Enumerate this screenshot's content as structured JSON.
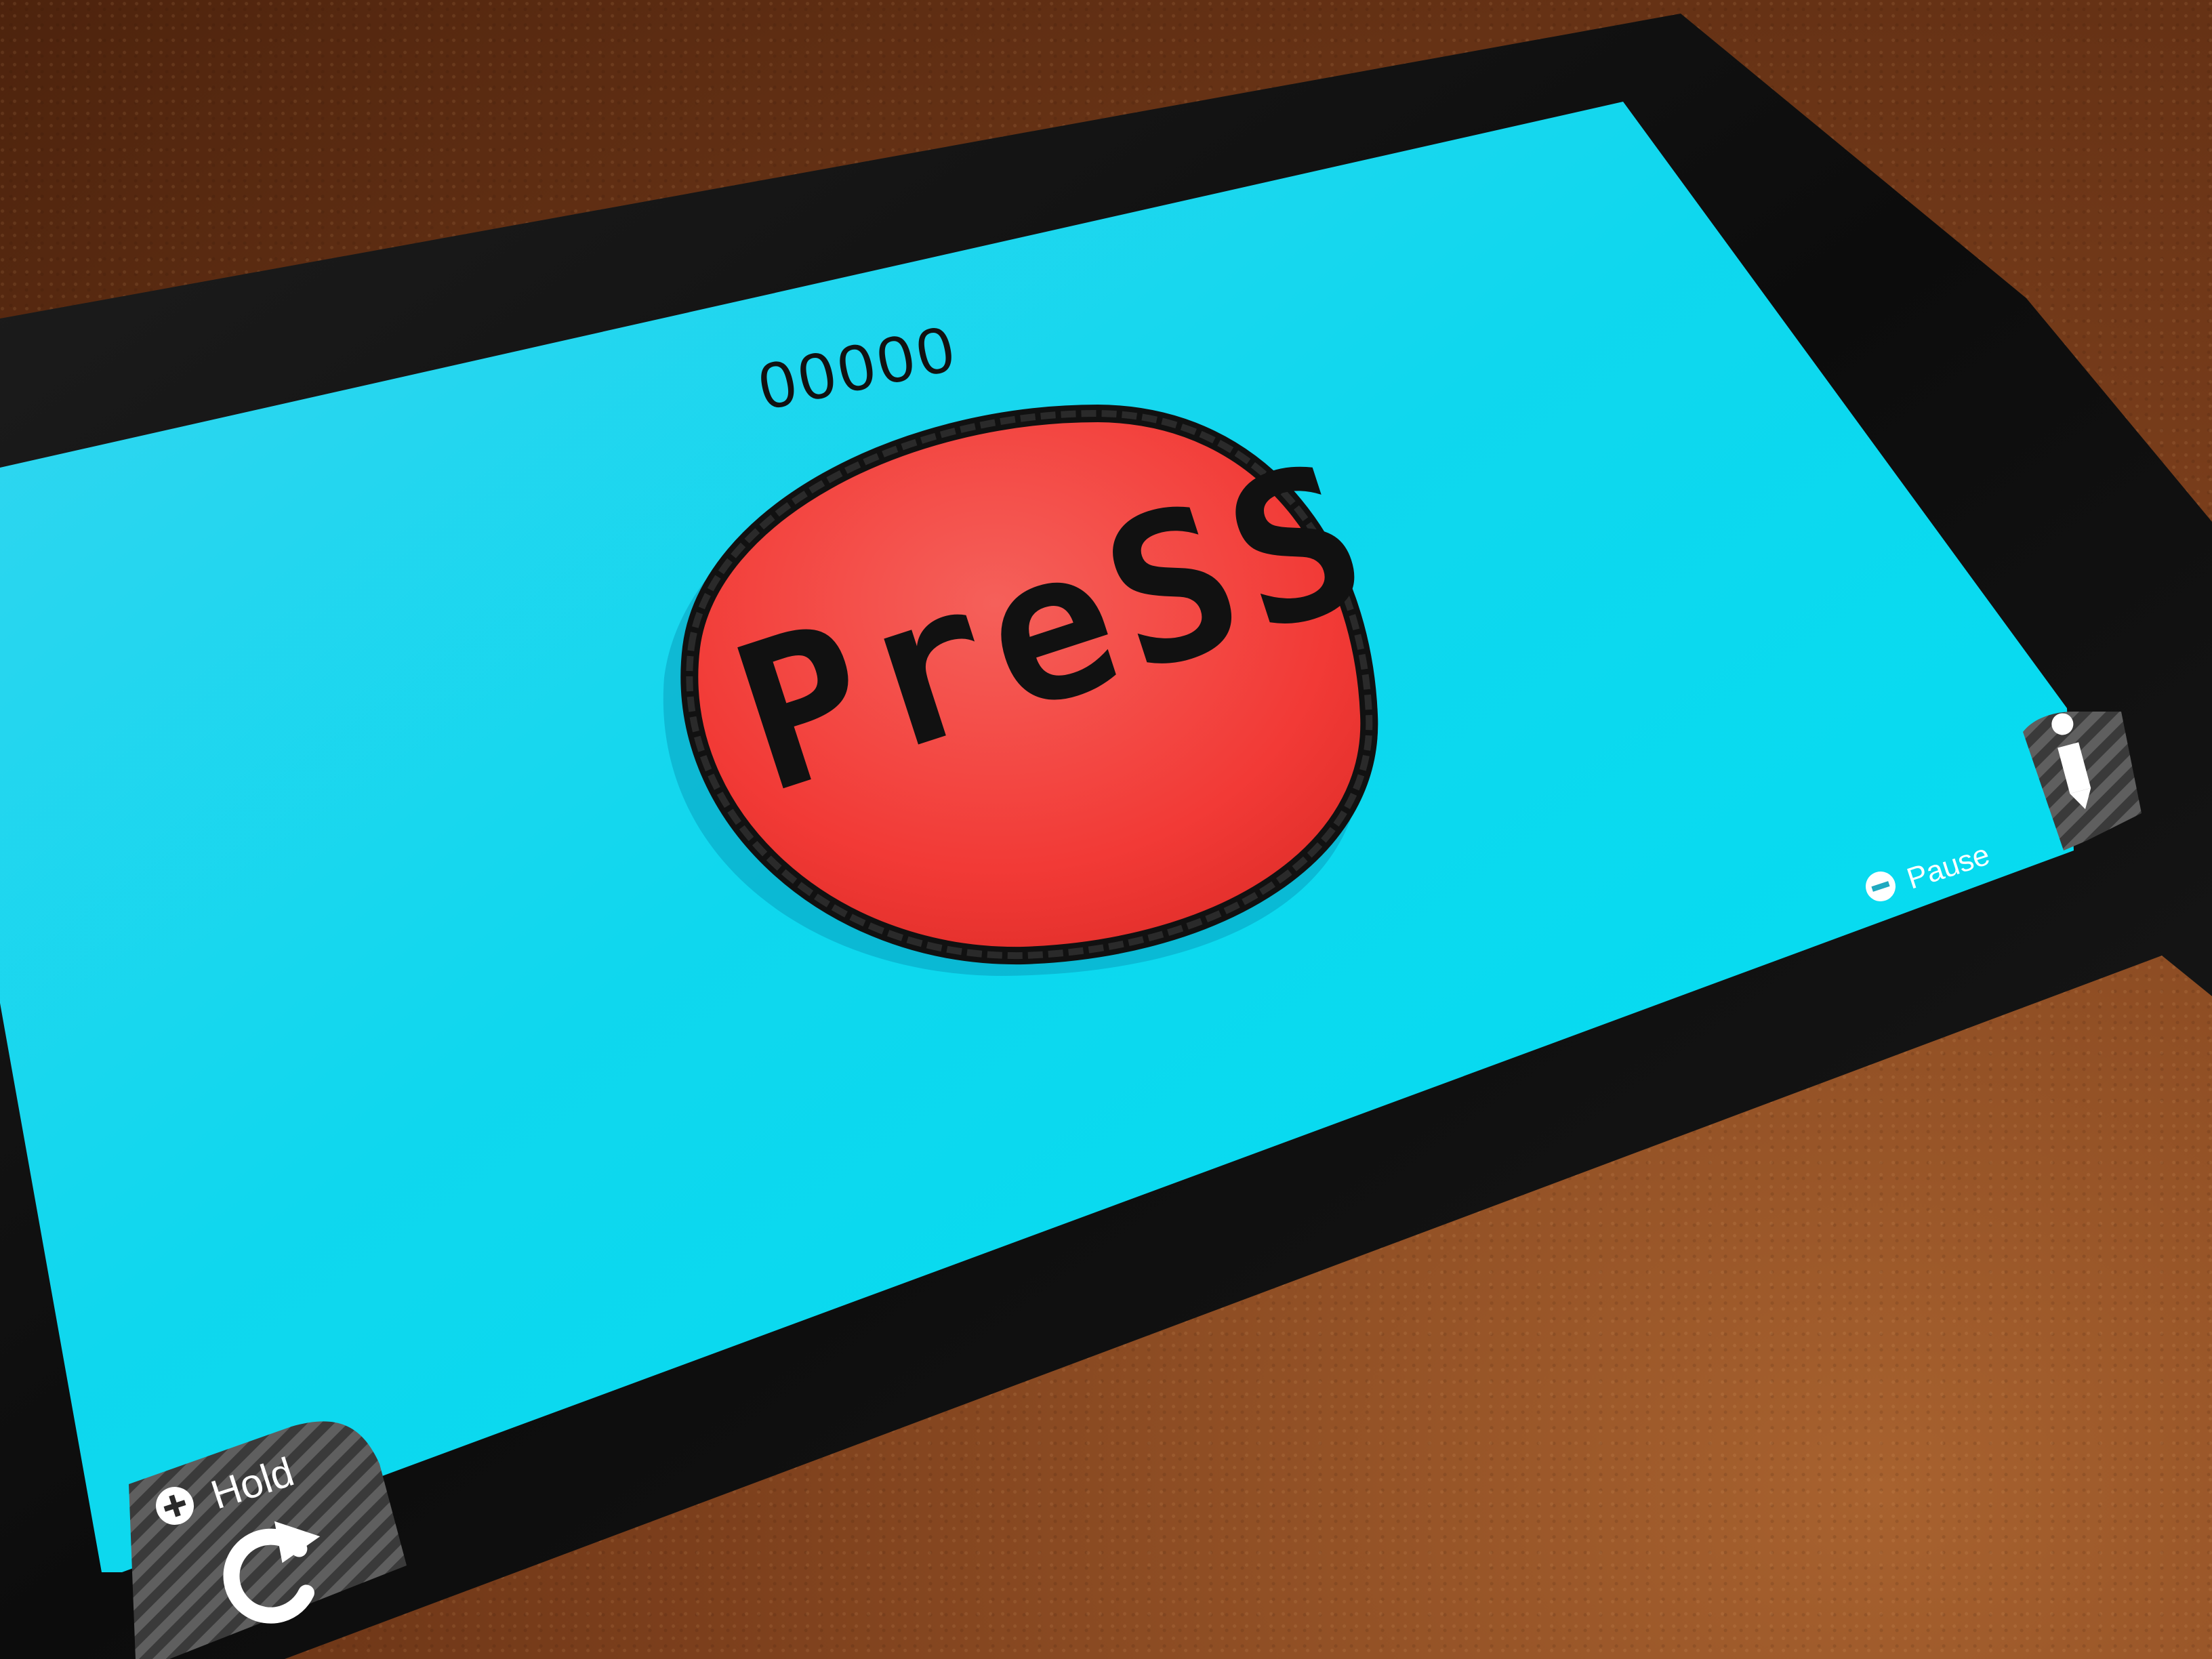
{
  "game": {
    "score": "00000",
    "button_label": "PreSS",
    "hold_label": "Hold",
    "pause_label": "Pause"
  },
  "icons": {
    "hold_button": "plus-circle-icon",
    "restart": "circular-arrow-icon",
    "pause_button": "minus-circle-icon",
    "info": "info-icon"
  },
  "colors": {
    "screen": "#00d9ef",
    "button_fill": "#f23a36",
    "button_outline": "#111111",
    "device_bezel": "#121212"
  }
}
